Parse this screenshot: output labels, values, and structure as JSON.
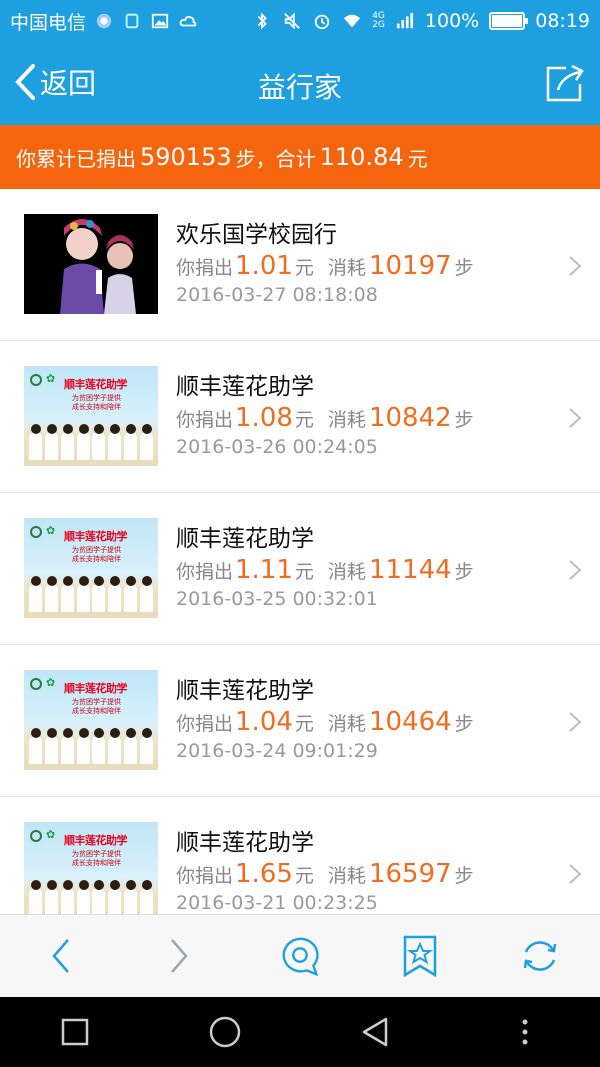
{
  "status_bar": {
    "carrier": "中国电信",
    "network_tag_top": "4G",
    "network_tag_bottom": "2G",
    "battery": "100%",
    "battery_level": 1.0,
    "time": "08:19"
  },
  "nav": {
    "back_label": "返回",
    "title": "益行家"
  },
  "summary": {
    "prefix": "你累计已捐出",
    "steps": "590153",
    "steps_unit": "步，合计",
    "amount": "110.84",
    "amount_unit": "元"
  },
  "colors": {
    "brand_blue": "#1e9fe0",
    "banner_orange": "#f5650e",
    "value_orange": "#f16c1e"
  },
  "list": {
    "donate_label": "你捐出",
    "yuan": "元",
    "consume_label": "消耗",
    "step_unit": "步",
    "items": [
      {
        "title": "欢乐国学校园行",
        "amount": "1.01",
        "steps": "10197",
        "time": "2016-03-27 08:18:08",
        "thumb": "opera-photo"
      },
      {
        "title": "顺丰莲花助学",
        "amount": "1.08",
        "steps": "10842",
        "time": "2016-03-26 00:24:05",
        "thumb": "beach-photo"
      },
      {
        "title": "顺丰莲花助学",
        "amount": "1.11",
        "steps": "11144",
        "time": "2016-03-25 00:32:01",
        "thumb": "beach-photo"
      },
      {
        "title": "顺丰莲花助学",
        "amount": "1.04",
        "steps": "10464",
        "time": "2016-03-24 09:01:29",
        "thumb": "beach-photo"
      },
      {
        "title": "顺丰莲花助学",
        "amount": "1.65",
        "steps": "16597",
        "time": "2016-03-21 00:23:25",
        "thumb": "beach-photo"
      }
    ]
  },
  "thumb_beach": {
    "title": "顺丰莲花助学",
    "sub1": "为贫困学子提供",
    "sub2": "成长支持和陪伴"
  },
  "toolbar": {
    "icons": [
      "back-arrow-icon",
      "forward-arrow-icon",
      "comment-icon",
      "bookmark-star-icon",
      "refresh-icon"
    ]
  },
  "system_nav": {
    "icons": [
      "recents-square-icon",
      "home-circle-icon",
      "back-triangle-icon",
      "menu-dots-icon"
    ]
  }
}
